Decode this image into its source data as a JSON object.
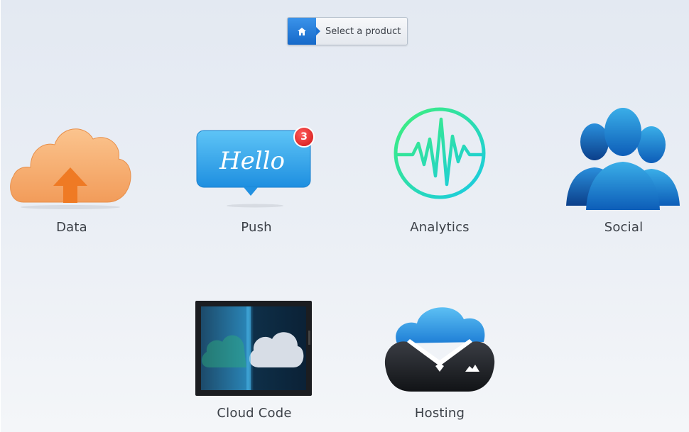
{
  "breadcrumb": {
    "home_icon": "home-icon",
    "label": "Select a product"
  },
  "products": [
    {
      "label": "Data",
      "icon": "cloud-upload-icon",
      "color": "#f6a868"
    },
    {
      "label": "Push",
      "icon": "hello-speech-bubble-icon",
      "bubble_text": "Hello",
      "badge": "3",
      "color": "#2aa0ec"
    },
    {
      "label": "Analytics",
      "icon": "pulse-waveform-icon",
      "color": "#26d9b8"
    },
    {
      "label": "Social",
      "icon": "people-group-icon",
      "color": "#1f6fc6"
    },
    {
      "label": "Cloud Code",
      "icon": "cloud-code-screen-icon",
      "color": "#1a3c5a"
    },
    {
      "label": "Hosting",
      "icon": "cloud-tuxedo-icon",
      "color": "#3a9ae6"
    }
  ]
}
